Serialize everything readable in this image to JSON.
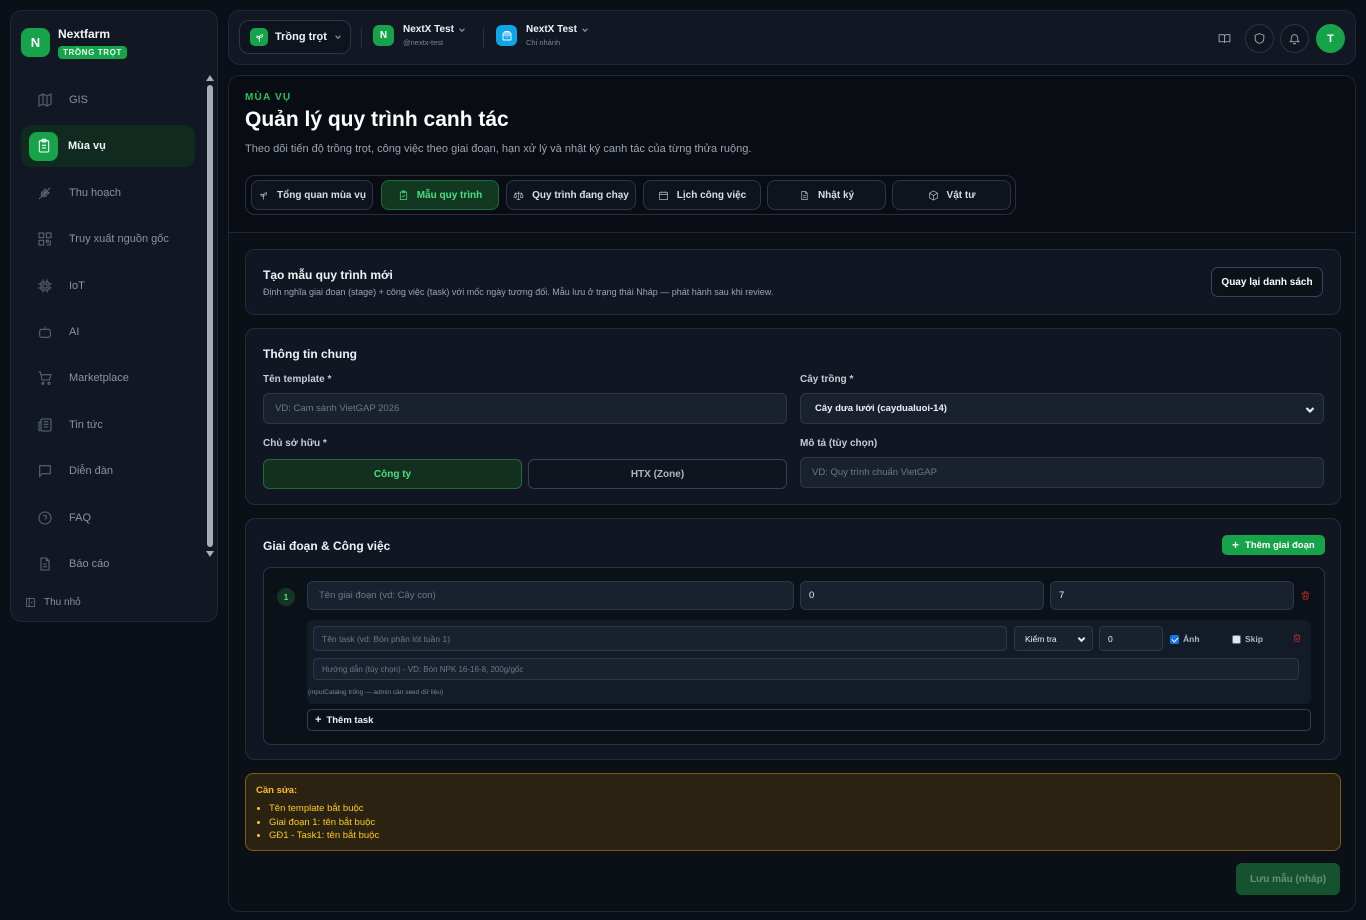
{
  "brand": {
    "name": "Nextfarm",
    "logo_letter": "N",
    "badge": "TRỒNG TRỌT"
  },
  "sidebar": {
    "items": [
      {
        "label": "GIS",
        "icon": "map-icon"
      },
      {
        "label": "Mùa vụ",
        "icon": "clipboard-icon",
        "active": true
      },
      {
        "label": "Thu hoạch",
        "icon": "wheat-icon"
      },
      {
        "label": "Truy xuất nguồn gốc",
        "icon": "qr-code-icon"
      },
      {
        "label": "IoT",
        "icon": "chip-icon"
      },
      {
        "label": "AI",
        "icon": "bot-icon"
      },
      {
        "label": "Marketplace",
        "icon": "cart-icon"
      },
      {
        "label": "Tin tức",
        "icon": "newspaper-icon"
      },
      {
        "label": "Diễn đàn",
        "icon": "chat-icon"
      },
      {
        "label": "FAQ",
        "icon": "help-circle-icon"
      },
      {
        "label": "Báo cáo",
        "icon": "file-icon"
      }
    ],
    "collapse_label": "Thu nhỏ"
  },
  "topbar": {
    "domain_label": "Trồng trọt",
    "org": {
      "letter": "N",
      "name": "NextX Test",
      "sub": "@nextx-test"
    },
    "branch": {
      "name": "NextX Test",
      "sub": "Chi nhánh"
    },
    "avatar_letter": "T"
  },
  "page": {
    "eyebrow": "MÙA VỤ",
    "title": "Quản lý quy trình canh tác",
    "description": "Theo dõi tiến độ trồng trọt, công việc theo giai đoạn, hạn xử lý và nhật ký canh tác của từng thửa ruộng.",
    "tabs": [
      {
        "label": "Tổng quan mùa vụ",
        "icon": "sprout-icon"
      },
      {
        "label": "Mẫu quy trình",
        "icon": "clipboard-check-icon",
        "active": true
      },
      {
        "label": "Quy trình đang chạy",
        "icon": "scale-icon"
      },
      {
        "label": "Lịch công việc",
        "icon": "calendar-icon"
      },
      {
        "label": "Nhật ký",
        "icon": "document-icon"
      },
      {
        "label": "Vật tư",
        "icon": "package-icon"
      }
    ]
  },
  "create_card": {
    "title": "Tạo mẫu quy trình mới",
    "subtitle": "Định nghĩa giai đoạn (stage) + công việc (task) với mốc ngày tương đối. Mẫu lưu ở trạng thái Nháp — phát hành sau khi review.",
    "back_button": "Quay lại danh sách"
  },
  "general": {
    "title": "Thông tin chung",
    "template_name_label": "Tên template *",
    "template_name_placeholder": "VD: Cam sành VietGAP 2026",
    "crop_label": "Cây trồng *",
    "crop_value": "Cây dưa lưới (caydualuoi-14)",
    "owner_label": "Chủ sở hữu *",
    "owner_options": [
      "Công ty",
      "HTX (Zone)"
    ],
    "owner_selected": "Công ty",
    "desc_label": "Mô tả (tùy chọn)",
    "desc_placeholder": "VD: Quy trình chuẩn VietGAP"
  },
  "stages": {
    "title": "Giai đoạn & Công việc",
    "add_stage_button": "Thêm giai đoạn",
    "stage": {
      "number": "1",
      "name_placeholder": "Tên giai đoạn (vd: Cây con)",
      "start_day": "0",
      "end_day": "7",
      "task": {
        "name_placeholder": "Tên task (vd: Bón phân lót tuần 1)",
        "type_value": "Kiểm tra",
        "offset_value": "0",
        "photo_label": "Ảnh",
        "photo_checked": true,
        "skip_label": "Skip",
        "skip_checked": false,
        "guide_placeholder": "Hướng dẫn (tùy chọn) - VD: Bón NPK 16-16-8, 200g/gốc",
        "hint": "(inputCatalog trống — admin cần seed dữ liệu)"
      },
      "add_task_button": "Thêm task"
    }
  },
  "warning": {
    "title": "Cần sửa:",
    "items": [
      "Tên template bắt buộc",
      "Giai đoạn 1: tên bắt buộc",
      "GĐ1 - Task1: tên bắt buộc"
    ]
  },
  "save_button": "Lưu mẫu (nháp)",
  "colors": {
    "accent": "#16a34a",
    "accent_text": "#4ade80",
    "warning_border": "#7a5a1a",
    "danger": "#dc2626"
  }
}
